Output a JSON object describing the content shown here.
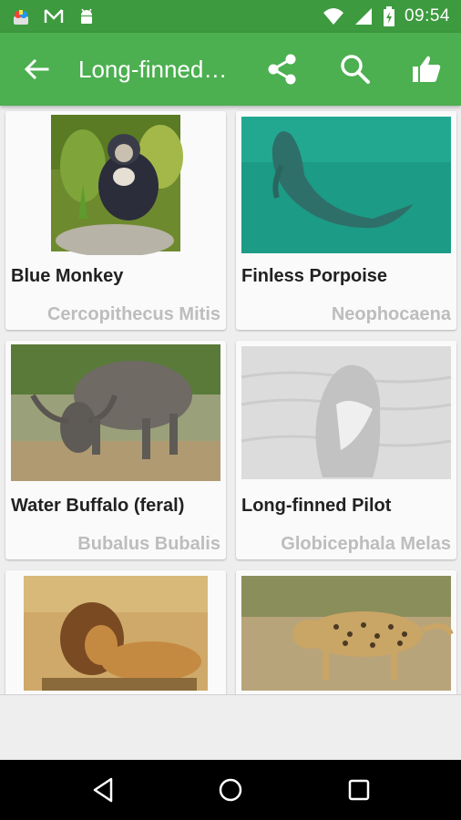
{
  "status_bar": {
    "time": "09:54",
    "left_icons": [
      "app-notification-icon",
      "gmail-icon",
      "android-icon"
    ],
    "right_icons": [
      "wifi-icon",
      "signal-icon",
      "battery-charging-icon"
    ]
  },
  "app_bar": {
    "title": "Long-finned…",
    "actions": [
      "share-icon",
      "search-icon",
      "like-icon"
    ],
    "color": "#4caf50"
  },
  "animals": [
    {
      "name": "Blue Monkey",
      "scientific": "Cercopithecus Mitis"
    },
    {
      "name": "Finless Porpoise",
      "scientific": "Neophocaena"
    },
    {
      "name": "Water Buffalo (feral)",
      "scientific": "Bubalus Bubalis"
    },
    {
      "name": "Long-finned Pilot",
      "scientific": "Globicephala Melas"
    },
    {
      "name": "",
      "scientific": ""
    },
    {
      "name": "",
      "scientific": ""
    }
  ],
  "nav_bar": {
    "buttons": [
      "nav-back-icon",
      "nav-home-icon",
      "nav-recents-icon"
    ]
  }
}
